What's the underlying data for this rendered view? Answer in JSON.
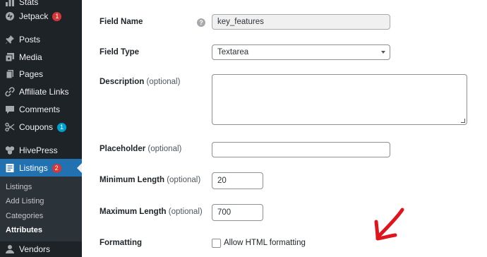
{
  "sidebar": {
    "items": [
      {
        "label": "Stats",
        "icon": "stats-icon"
      },
      {
        "label": "Jetpack",
        "icon": "jetpack-icon",
        "badge": "1",
        "badge_color": "#d63638"
      },
      {
        "label": "Posts",
        "icon": "pin-icon"
      },
      {
        "label": "Media",
        "icon": "media-icon"
      },
      {
        "label": "Pages",
        "icon": "pages-icon"
      },
      {
        "label": "Affiliate Links",
        "icon": "link-icon"
      },
      {
        "label": "Comments",
        "icon": "comment-icon"
      },
      {
        "label": "Coupons",
        "icon": "scissors-icon",
        "badge": "1",
        "badge_color": "#00a0d2"
      },
      {
        "label": "HivePress",
        "icon": "hivepress-icon"
      },
      {
        "label": "Listings",
        "icon": "listings-icon",
        "badge": "2",
        "badge_color": "#d63638"
      },
      {
        "label": "Vendors",
        "icon": "vendors-icon"
      }
    ],
    "submenu": [
      "Listings",
      "Add Listing",
      "Categories",
      "Attributes"
    ],
    "active_submenu": "Attributes"
  },
  "form": {
    "field_name": {
      "label": "Field Name",
      "value": "key_features"
    },
    "field_type": {
      "label": "Field Type",
      "value": "Textarea"
    },
    "description": {
      "label": "Description",
      "optional": "(optional)",
      "value": ""
    },
    "placeholder": {
      "label": "Placeholder",
      "optional": "(optional)",
      "value": ""
    },
    "min_length": {
      "label": "Minimum Length",
      "optional": "(optional)",
      "value": "20"
    },
    "max_length": {
      "label": "Maximum Length",
      "optional": "(optional)",
      "value": "700"
    },
    "formatting": {
      "label": "Formatting",
      "checkbox_label": "Allow HTML formatting",
      "checked": false
    }
  },
  "colors": {
    "sidebar_bg": "#1d2327",
    "active_menu": "#2271b1",
    "annotation_arrow": "#e0141c"
  }
}
